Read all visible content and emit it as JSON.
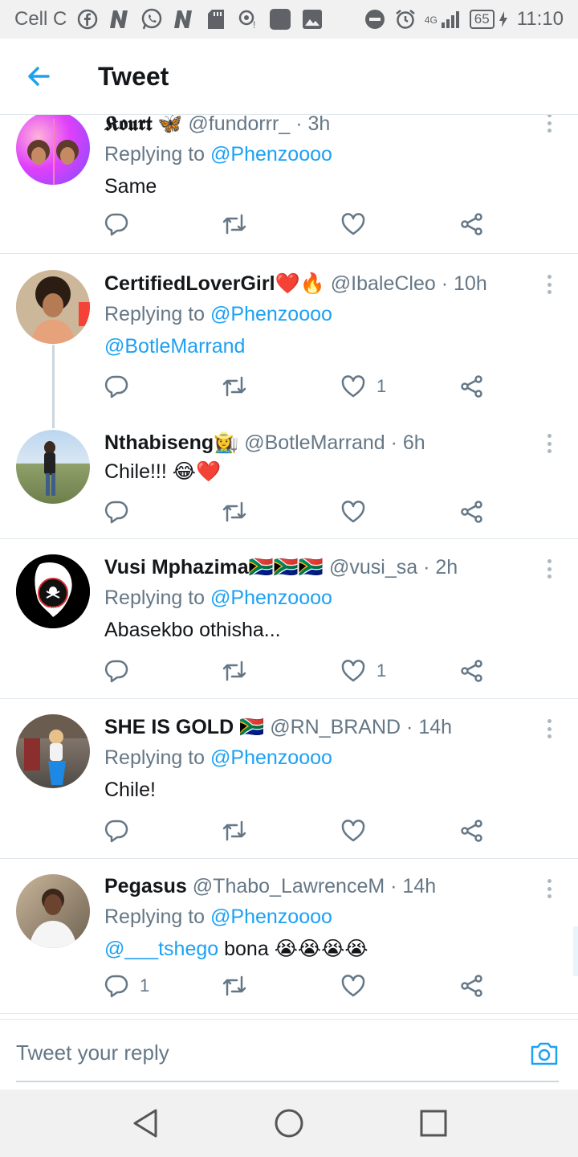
{
  "status_bar": {
    "carrier": "Cell C",
    "network": "4G",
    "battery": "65",
    "time": "11:10"
  },
  "header": {
    "title": "Tweet"
  },
  "tweets": [
    {
      "name": "𝕶𝖔𝖚𝖗𝖙",
      "name_emoji": "🦋",
      "handle": "@fundorrr_",
      "time": "· 3h",
      "replying_prefix": "Replying to",
      "replying_to": "@Phenzoooo",
      "text": "Same",
      "likes": ""
    },
    {
      "name": "CertifiedLoverGirl",
      "name_emoji": "❤️🔥",
      "handle": "@IbaleCleo",
      "time": "· 10h",
      "replying_prefix": "Replying to",
      "replying_to": "@Phenzoooo",
      "text_mention": "@BotleMarrand",
      "likes": "1"
    },
    {
      "name": "Nthabiseng",
      "name_emoji": "👩‍🌾",
      "handle": "@BotleMarrand",
      "time": "· 6h",
      "text": "Chile!!!",
      "text_emoji": "😂❤️",
      "likes": ""
    },
    {
      "name": "Vusi Mphazima",
      "name_emoji": "🇿🇦🇿🇦🇿🇦",
      "handle": "@vusi_sa",
      "time": "· 2h",
      "replying_prefix": "Replying to",
      "replying_to": "@Phenzoooo",
      "text": "Abasekbo othisha...",
      "likes": "1"
    },
    {
      "name": "SHE IS GOLD",
      "name_emoji": "🇿🇦",
      "handle": "@RN_BRAND",
      "time": "· 14h",
      "replying_prefix": "Replying to",
      "replying_to": "@Phenzoooo",
      "text": "Chile!",
      "likes": ""
    },
    {
      "name": "Pegasus",
      "handle": "@Thabo_LawrenceM",
      "time": "· 14h",
      "replying_prefix": "Replying to",
      "replying_to": "@Phenzoooo",
      "text_mention": "@___tshego",
      "text": "bona",
      "text_emoji": "😭😭😭😭",
      "replies": "1",
      "likes": ""
    }
  ],
  "reply_bar": {
    "placeholder": "Tweet your reply"
  },
  "icons": {
    "back": "arrow-left-icon",
    "reply": "comment-icon",
    "retweet": "retweet-icon",
    "like": "heart-icon",
    "share": "share-icon",
    "more": "more-vertical-icon",
    "camera": "camera-icon"
  },
  "colors": {
    "accent": "#1da1f2",
    "secondary_text": "#657786",
    "divider": "#e1e8ed"
  }
}
